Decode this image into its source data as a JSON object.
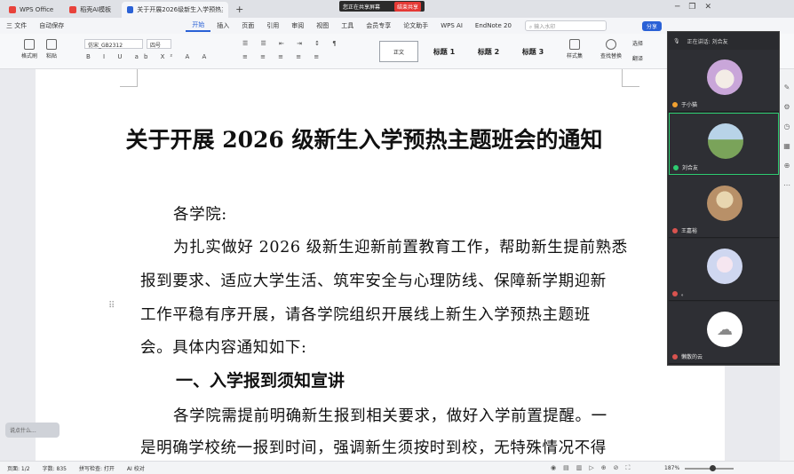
{
  "titlebar": {
    "tabs": [
      {
        "label": "WPS Office",
        "icon": "wps-logo-icon",
        "color": "#e8423b"
      },
      {
        "label": "稻壳AI模板",
        "icon": "docer-icon",
        "color": "#e8423b"
      },
      {
        "label": "关于开展2026级新生入学预热主...",
        "icon": "word-doc-icon",
        "color": "#2a61d6"
      }
    ],
    "new_tab": "+",
    "sharing_text": "您正在共享屏幕",
    "stop_sharing": "结束共享"
  },
  "menubar": {
    "file": "三 文件",
    "autosave": "自动保存",
    "items": [
      "开始",
      "插入",
      "页面",
      "引用",
      "审阅",
      "视图",
      "工具",
      "会员专享",
      "论文助手",
      "WPS AI",
      "EndNote 20"
    ],
    "active": "开始",
    "search_placeholder": "输入水印",
    "share": "分享"
  },
  "ribbon": {
    "format_painter": "格式刷",
    "paste": "粘贴",
    "font_name": "仿宋_GB2312",
    "font_size": "四号",
    "styles": [
      "正文",
      "标题 1",
      "标题 2",
      "标题 3"
    ],
    "style_set": "样式集",
    "find_replace": "查找替换",
    "select": "选择",
    "translate": "翻译"
  },
  "document": {
    "title": "关于开展 2026 级新生入学预热主题班会的通知",
    "salutation": "各学院:",
    "para1": [
      "为扎实做好 2026 级新生迎新前置教育工作，帮助新生提前熟悉",
      "报到要求、适应大学生活、筑牢安全与心理防线、保障新学期迎新",
      "工作平稳有序开展，请各学院组织开展线上新生入学预热主题班",
      "会。具体内容通知如下:"
    ],
    "heading1": "一、入学报到须知宣讲",
    "para2": [
      "各学院需提前明确新生报到相关要求，做好入学前置提醒。一",
      "是明确学校统一报到时间，强调新生须按时到校，无特殊情况不得"
    ]
  },
  "voice_input": "说点什么...",
  "meeting": {
    "speaking_label": "正在讲话:",
    "speaking_name": "刘合友",
    "participants": [
      {
        "name": "于小猫",
        "avatar": "cat-avatar-icon",
        "color": "#c9a6d9"
      },
      {
        "name": "刘合友",
        "avatar": "field-photo-avatar-icon",
        "color": "#7aa35a"
      },
      {
        "name": "王嘉裕",
        "avatar": "room-avatar-icon",
        "color": "#b89068"
      },
      {
        "name": "。",
        "avatar": "anime-avatar-icon",
        "color": "#cfd7f0"
      },
      {
        "name": "懒散的云",
        "avatar": "cloud-avatar-icon",
        "color": "#ffffff"
      }
    ]
  },
  "statusbar": {
    "page": "页面: 1/2",
    "word_count": "字数: 835",
    "spellcheck": "拼写检查: 打开",
    "ai_check": "AI 校对",
    "zoom": "187%"
  }
}
